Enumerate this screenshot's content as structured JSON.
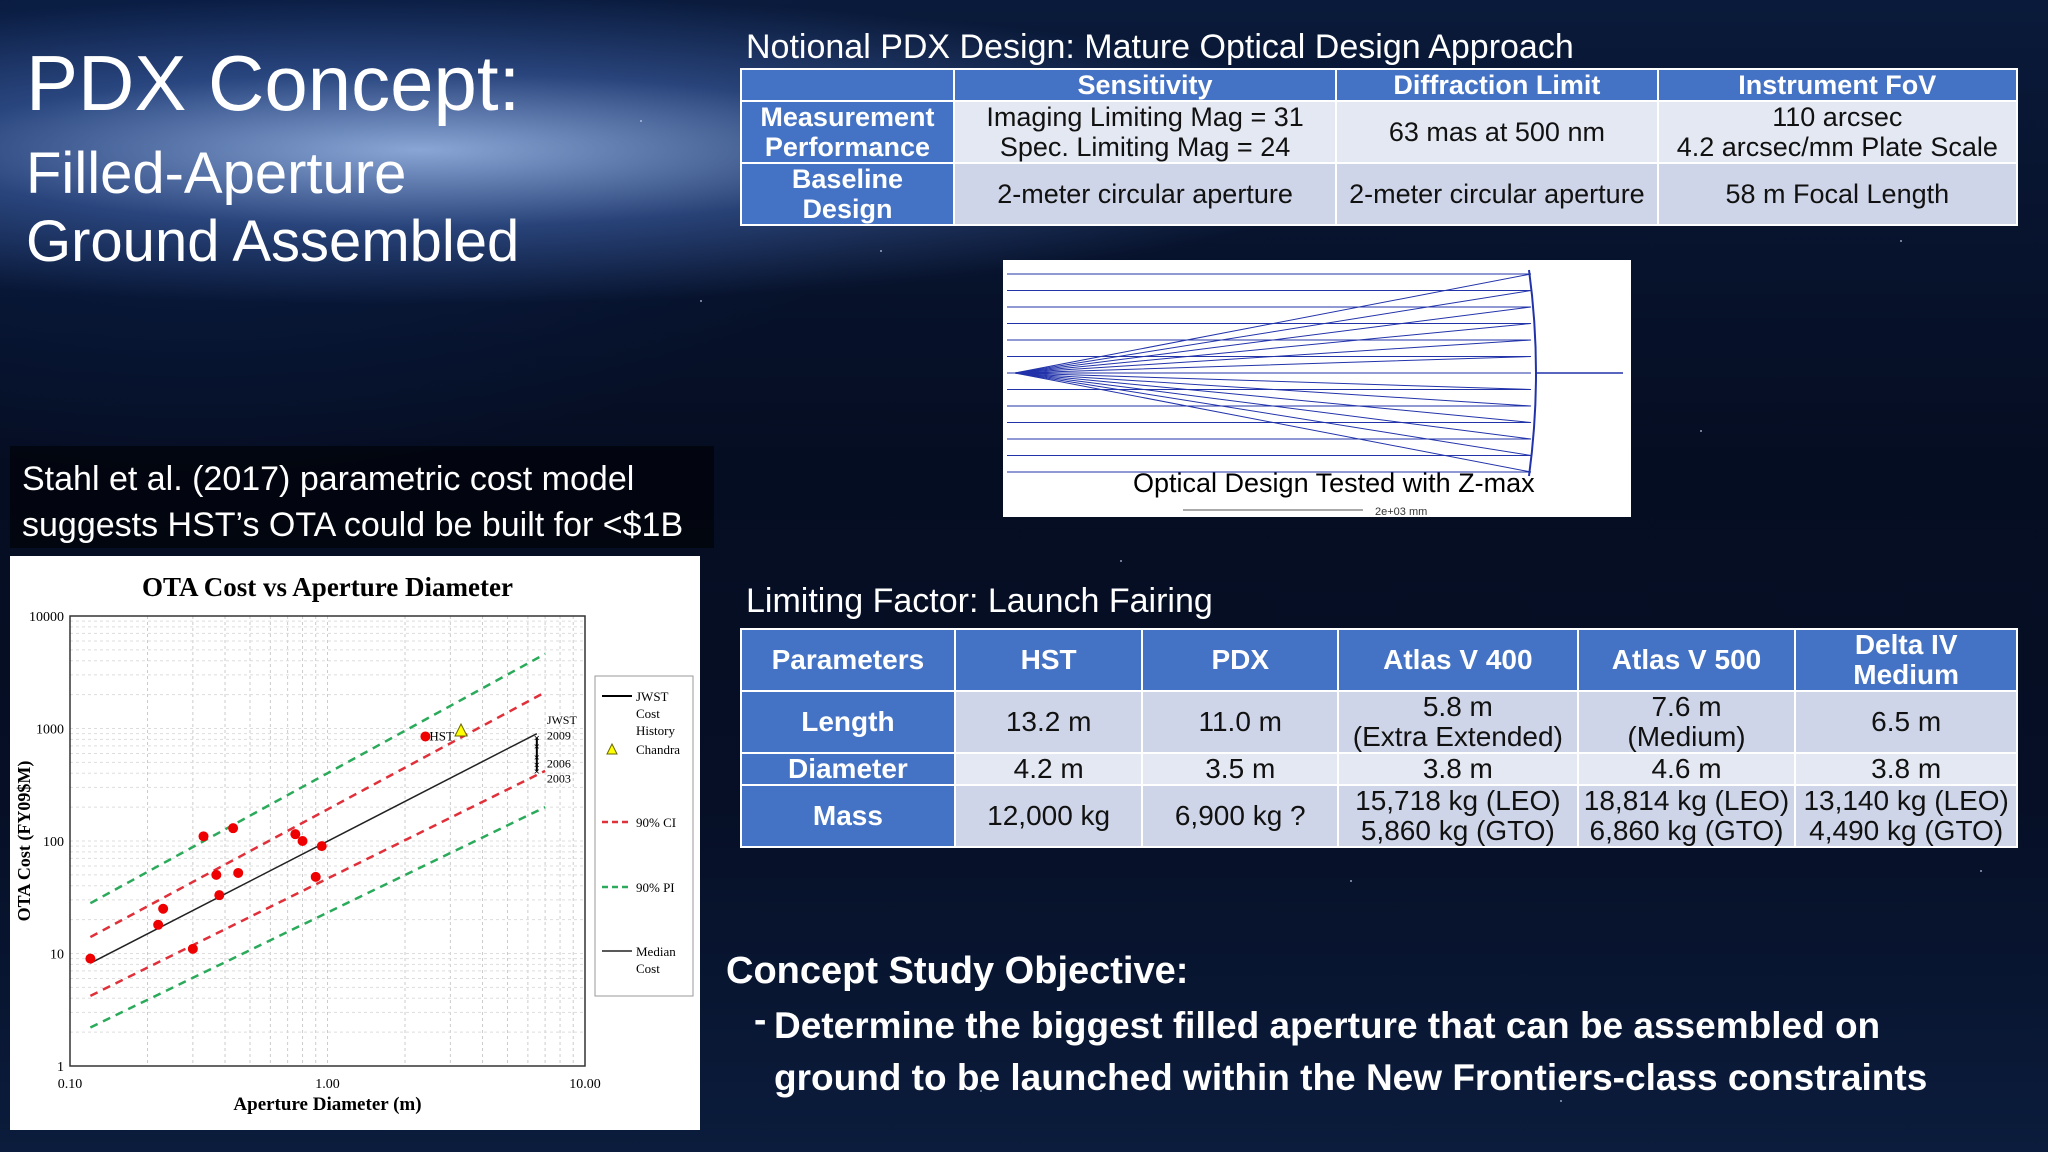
{
  "slide": {
    "title": "PDX Concept:",
    "subtitle_line1": "Filled-Aperture",
    "subtitle_line2": "Ground Assembled"
  },
  "design_table": {
    "heading": "Notional PDX Design: Mature Optical Design Approach",
    "columns": [
      "",
      "Sensitivity",
      "Diffraction Limit",
      "Instrument FoV"
    ],
    "rows": [
      {
        "label": "Measurement Performance",
        "cells": [
          "Imaging Limiting Mag = 31\nSpec. Limiting Mag = 24",
          "63 mas at 500 nm",
          "110 arcsec\n4.2 arcsec/mm Plate Scale"
        ]
      },
      {
        "label": "Baseline Design",
        "cells": [
          "2-meter circular aperture",
          "2-meter circular aperture",
          "58 m Focal Length"
        ]
      }
    ]
  },
  "optical_figure": {
    "caption": "Optical Design Tested with Z-max",
    "scale_label": "2e+03 mm"
  },
  "cost_model": {
    "statement": "Stahl et al. (2017) parametric cost model suggests HST’s OTA could be built for <$1B"
  },
  "chart_data": {
    "type": "scatter",
    "title": "OTA Cost vs Aperture Diameter",
    "xlabel": "Aperture Diameter (m)",
    "ylabel": "OTA Cost (FY09$M)",
    "xscale": "log",
    "yscale": "log",
    "xlim": [
      0.1,
      10
    ],
    "ylim": [
      1,
      10000
    ],
    "xticks": [
      "0.10",
      "1.00",
      "10.00"
    ],
    "yticks": [
      "1",
      "10",
      "100",
      "1000",
      "10000"
    ],
    "grid": true,
    "legend_position": "right",
    "legend": [
      "JWST Cost History",
      "Chandra",
      "90% CI",
      "90% PI",
      "Median Cost"
    ],
    "points": [
      {
        "x": 0.12,
        "y": 9
      },
      {
        "x": 0.22,
        "y": 18
      },
      {
        "x": 0.23,
        "y": 25
      },
      {
        "x": 0.3,
        "y": 11
      },
      {
        "x": 0.33,
        "y": 110
      },
      {
        "x": 0.37,
        "y": 50
      },
      {
        "x": 0.38,
        "y": 33
      },
      {
        "x": 0.45,
        "y": 52
      },
      {
        "x": 0.43,
        "y": 130
      },
      {
        "x": 0.75,
        "y": 115
      },
      {
        "x": 0.8,
        "y": 100
      },
      {
        "x": 0.9,
        "y": 48
      },
      {
        "x": 0.95,
        "y": 90
      },
      {
        "x": 2.4,
        "y": 850
      }
    ],
    "chandra": {
      "x": 3.3,
      "y": 950
    },
    "jwst_history": {
      "x": 6.5,
      "values": [
        830,
        700,
        560,
        480,
        420
      ]
    },
    "annotations": [
      "HST",
      "JWST",
      "2009",
      "2006",
      "2003"
    ],
    "median_fit": {
      "x": [
        0.12,
        6.5
      ],
      "y": [
        8.2,
        900
      ]
    },
    "ci90": {
      "upper": {
        "x": [
          0.12,
          7
        ],
        "y": [
          14,
          2100
        ]
      },
      "lower": {
        "x": [
          0.12,
          7
        ],
        "y": [
          4.2,
          420
        ]
      }
    },
    "pi90": {
      "upper": {
        "x": [
          0.12,
          7
        ],
        "y": [
          28,
          4600
        ]
      },
      "lower": {
        "x": [
          0.12,
          7
        ],
        "y": [
          2.2,
          200
        ]
      }
    }
  },
  "fairing_table": {
    "heading": "Limiting Factor: Launch Fairing",
    "columns": [
      "Parameters",
      "HST",
      "PDX",
      "Atlas V 400",
      "Atlas V 500",
      "Delta IV Medium"
    ],
    "rows": [
      {
        "label": "Length",
        "cells": [
          "13.2 m",
          "11.0 m",
          "5.8 m\n(Extra Extended)",
          "7.6 m\n(Medium)",
          "6.5 m"
        ]
      },
      {
        "label": "Diameter",
        "cells": [
          "4.2 m",
          "3.5 m",
          "3.8 m",
          "4.6 m",
          "3.8 m"
        ]
      },
      {
        "label": "Mass",
        "cells": [
          "12,000 kg",
          "6,900 kg ?",
          "15,718 kg (LEO)\n5,860 kg (GTO)",
          "18,814 kg (LEO)\n6,860 kg (GTO)",
          "13,140 kg (LEO)\n4,490 kg (GTO)"
        ]
      }
    ]
  },
  "objective": {
    "heading": "Concept Study Objective:",
    "bullet": "Determine the biggest filled aperture that can be assembled on ground to be launched within the New Frontiers-class constraints"
  }
}
